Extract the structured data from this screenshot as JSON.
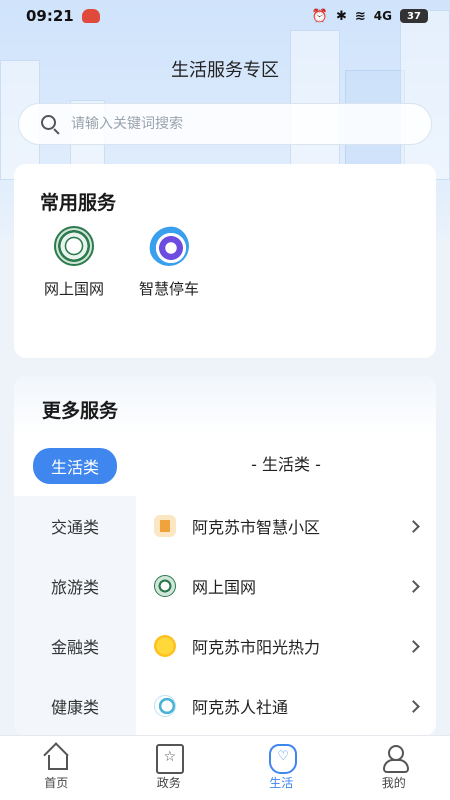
{
  "status_bar": {
    "time": "09:21",
    "battery": "37",
    "network": "4G"
  },
  "header": {
    "title": "生活服务专区"
  },
  "search": {
    "placeholder": "请输入关键词搜索"
  },
  "common_services": {
    "title": "常用服务",
    "items": [
      {
        "label": "网上国网",
        "icon": "state-grid-icon"
      },
      {
        "label": "智慧停车",
        "icon": "smart-parking-icon"
      }
    ]
  },
  "more_services": {
    "title": "更多服务",
    "categories": [
      "生活类",
      "交通类",
      "旅游类",
      "金融类",
      "健康类"
    ],
    "active_category": "生活类",
    "section_heading": "- 生活类 -",
    "items": [
      {
        "label": "阿克苏市智慧小区",
        "icon": "community-icon"
      },
      {
        "label": "网上国网",
        "icon": "state-grid-icon"
      },
      {
        "label": "阿克苏市阳光热力",
        "icon": "sun-icon"
      },
      {
        "label": "阿克苏人社通",
        "icon": "social-security-icon"
      }
    ]
  },
  "tabbar": {
    "items": [
      {
        "label": "首页",
        "icon": "home-icon"
      },
      {
        "label": "政务",
        "icon": "government-icon"
      },
      {
        "label": "生活",
        "icon": "life-icon"
      },
      {
        "label": "我的",
        "icon": "profile-icon"
      }
    ],
    "active": "生活"
  },
  "colors": {
    "accent": "#3f86ef",
    "background": "#eef3f9"
  }
}
